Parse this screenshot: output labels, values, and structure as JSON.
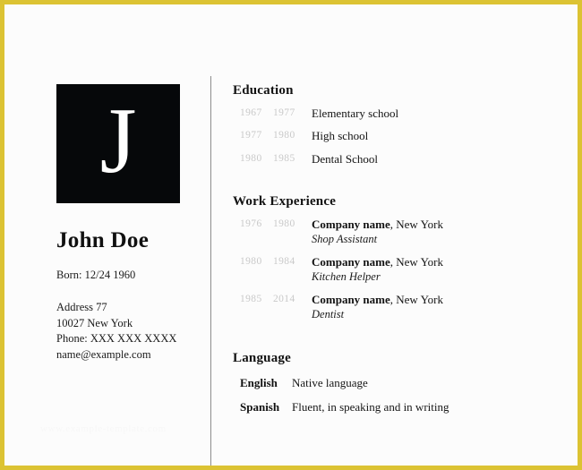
{
  "theme": {
    "border_color": "#dcc333",
    "page_background": "#fcfcfc",
    "photo_background": "#06080a",
    "year_color": "#c9c9c9",
    "divider_color": "#8d8d8d"
  },
  "profile": {
    "photo_initial": "J",
    "name": "John Doe",
    "born": "Born: 12/24 1960",
    "address_line1": "Address 77",
    "address_line2": "10027 New York",
    "phone": "Phone: XXX XXX XXXX",
    "email": "name@example.com"
  },
  "education": {
    "title": "Education",
    "entries": [
      {
        "start": "1967",
        "end": "1977",
        "name": "Elementary school"
      },
      {
        "start": "1977",
        "end": "1980",
        "name": "High school"
      },
      {
        "start": "1980",
        "end": "1985",
        "name": "Dental School"
      }
    ]
  },
  "work": {
    "title": "Work Experience",
    "entries": [
      {
        "start": "1976",
        "end": "1980",
        "org": "Company name",
        "location": ", New York",
        "role": "Shop Assistant"
      },
      {
        "start": "1980",
        "end": "1984",
        "org": "Company name",
        "location": ", New York",
        "role": "Kitchen Helper"
      },
      {
        "start": "1985",
        "end": "2014",
        "org": "Company name",
        "location": ", New York",
        "role": "Dentist"
      }
    ]
  },
  "language": {
    "title": "Language",
    "rows": [
      {
        "name": "English",
        "level": "Native language"
      },
      {
        "name": "Spanish",
        "level": "Fluent, in speaking and in writing"
      }
    ]
  },
  "watermark": {
    "text": "www.example-template.com"
  }
}
